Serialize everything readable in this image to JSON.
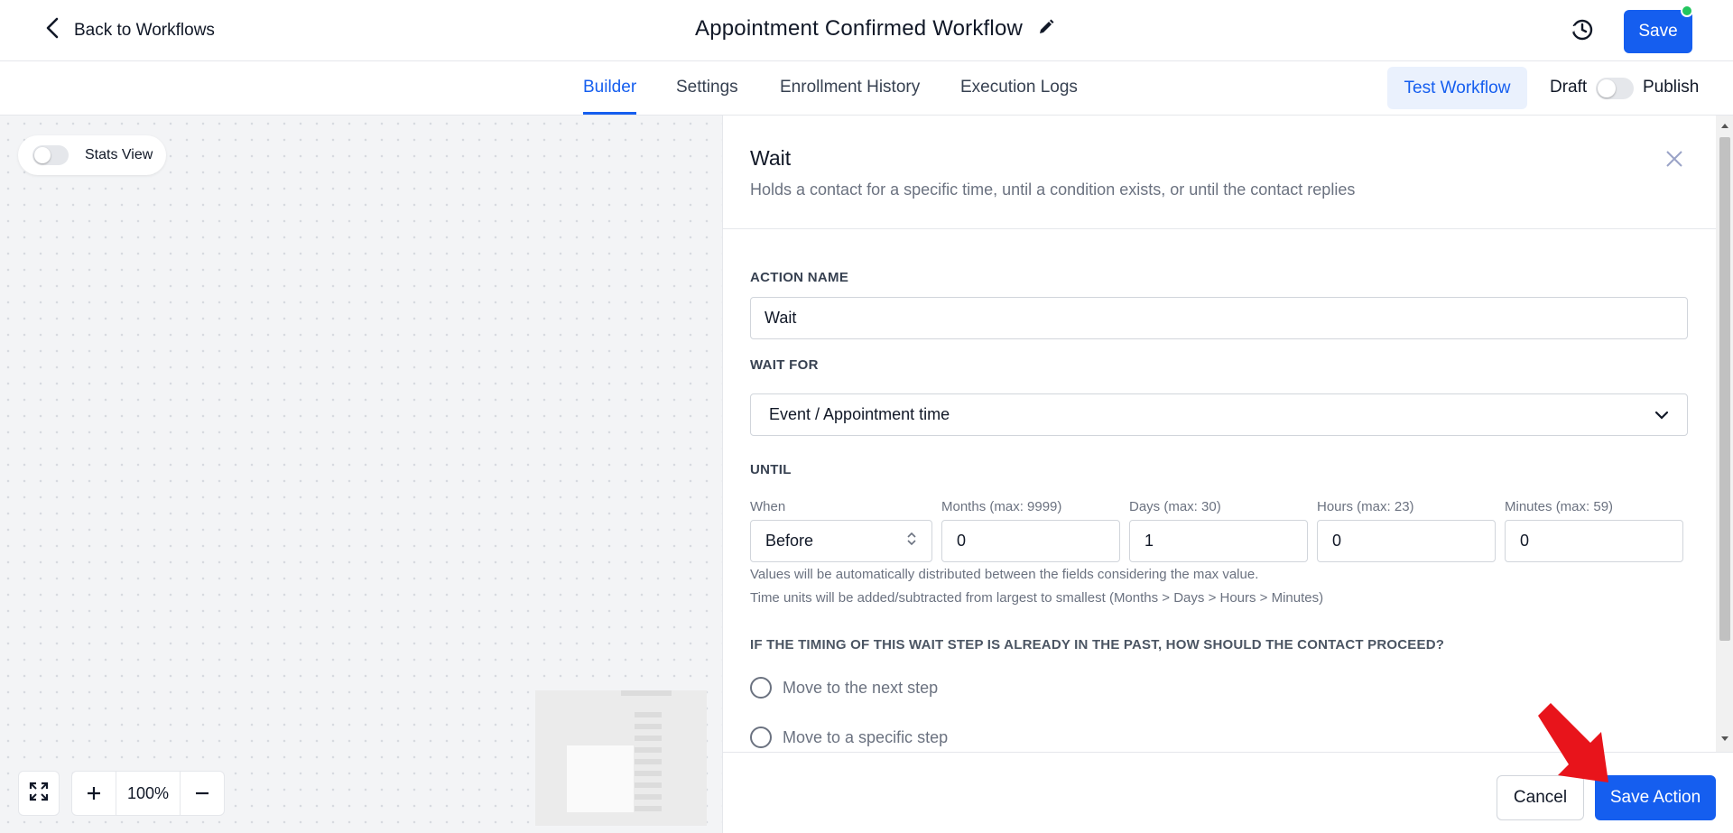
{
  "header": {
    "back_label": "Back to Workflows",
    "title": "Appointment Confirmed Workflow",
    "save_label": "Save"
  },
  "tabs": [
    {
      "label": "Builder",
      "active": true
    },
    {
      "label": "Settings",
      "active": false
    },
    {
      "label": "Enrollment History",
      "active": false
    },
    {
      "label": "Execution Logs",
      "active": false
    }
  ],
  "toolbar": {
    "test_label": "Test Workflow",
    "draft_label": "Draft",
    "publish_label": "Publish",
    "published": false
  },
  "canvas": {
    "stats_label": "Stats View",
    "stats_enabled": false,
    "zoom_value": "100%"
  },
  "panel": {
    "title": "Wait",
    "description": "Holds a contact for a specific time, until a condition exists, or until the contact replies",
    "action_name_label": "ACTION NAME",
    "action_name_value": "Wait",
    "wait_for_label": "WAIT FOR",
    "wait_for_value": "Event / Appointment time",
    "until_label": "UNTIL",
    "fields": {
      "when_label": "When",
      "when_value": "Before",
      "months_label": "Months (max: 9999)",
      "months_value": "0",
      "days_label": "Days (max: 30)",
      "days_value": "1",
      "hours_label": "Hours (max: 23)",
      "hours_value": "0",
      "minutes_label": "Minutes (max: 59)",
      "minutes_value": "0"
    },
    "hint_1": "Values will be automatically distributed between the fields considering the max value.",
    "hint_2": "Time units will be added/subtracted from largest to smallest (Months > Days > Hours > Minutes)",
    "question": "IF THE TIMING OF THIS WAIT STEP IS ALREADY IN THE PAST, HOW SHOULD THE CONTACT PROCEED?",
    "options": [
      "Move to the next step",
      "Move to a specific step"
    ],
    "cancel_label": "Cancel",
    "save_action_label": "Save Action"
  },
  "colors": {
    "primary": "#155eef",
    "status_dot": "#22c55e",
    "annotation_arrow": "#e8141b"
  }
}
